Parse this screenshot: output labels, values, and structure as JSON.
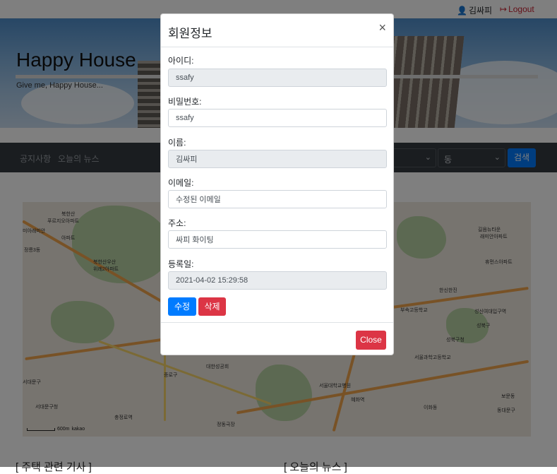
{
  "topbar": {
    "user_name": "김싸피",
    "logout_label": "Logout"
  },
  "hero": {
    "title": "Happy House",
    "subtitle": "Give me, Happy House..."
  },
  "nav": {
    "items": [
      "공지사항",
      "오늘의 뉴스"
    ],
    "dong_select": "동",
    "search_label": "검색"
  },
  "map": {
    "labels": [
      "북한산",
      "푸르지오아파트",
      "미아래미안",
      "아파트",
      "정릉3동",
      "북한산우산",
      "위례2아파트",
      "길음뉴타운",
      "래미안아파트",
      "휴먼스아파트",
      "한신한진",
      "부속고등학교",
      "성신여대입구역",
      "성북구",
      "서울과학고등학교",
      "대한성공회",
      "서대문구",
      "서대문구청",
      "종로구",
      "충정로역",
      "정동극장",
      "동대문구",
      "성북구청",
      "보문동",
      "서울대학교병원",
      "혜화역",
      "이화동",
      "kakao"
    ],
    "scale_text": "600m"
  },
  "bottom": {
    "left_heading": "[ 주택 관련 기사 ]",
    "right_heading": "[ 오늘의 뉴스 ]"
  },
  "modal": {
    "title": "회원정보",
    "close_x": "×",
    "fields": [
      {
        "label": "아이디:",
        "value": "ssafy",
        "readonly": true
      },
      {
        "label": "비밀번호:",
        "value": "ssafy",
        "readonly": false
      },
      {
        "label": "이름:",
        "value": "김싸피",
        "readonly": true
      },
      {
        "label": "이메일:",
        "value": "수정된 이메일",
        "readonly": false
      },
      {
        "label": "주소:",
        "value": "싸피 화이팅",
        "readonly": false
      },
      {
        "label": "등록일:",
        "value": "2021-04-02 15:29:58",
        "readonly": true
      }
    ],
    "edit_label": "수정",
    "delete_label": "삭제",
    "close_label": "Close"
  },
  "colors": {
    "primary": "#007bff",
    "danger": "#dc3545",
    "nav_bg": "#343a40"
  }
}
